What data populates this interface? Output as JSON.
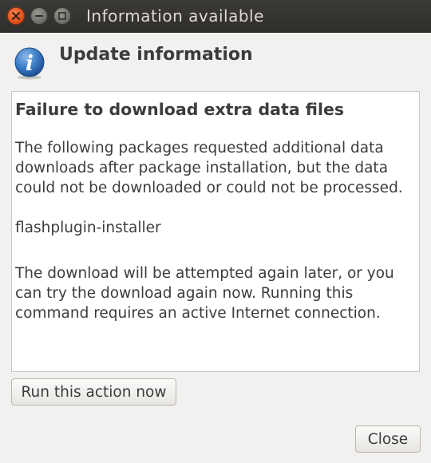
{
  "window": {
    "title": "Information available",
    "controls": [
      "close",
      "minimize",
      "maximize"
    ]
  },
  "header": {
    "icon": "info-icon",
    "title": "Update information"
  },
  "message": {
    "heading": "Failure to download extra data files",
    "paragraph1": "The following packages requested additional data downloads after package installation, but the data could not be downloaded or could not be processed.",
    "package": "flashplugin-installer",
    "paragraph2": "The download will be attempted again later, or you can try the download again now. Running this command requires an active Internet connection."
  },
  "buttons": {
    "run_action": "Run this action now",
    "close": "Close"
  },
  "colors": {
    "titlebar": "#3b3a36",
    "close_button": "#e2531c",
    "background": "#f2f1f0",
    "info_icon": "#2e6db4"
  }
}
